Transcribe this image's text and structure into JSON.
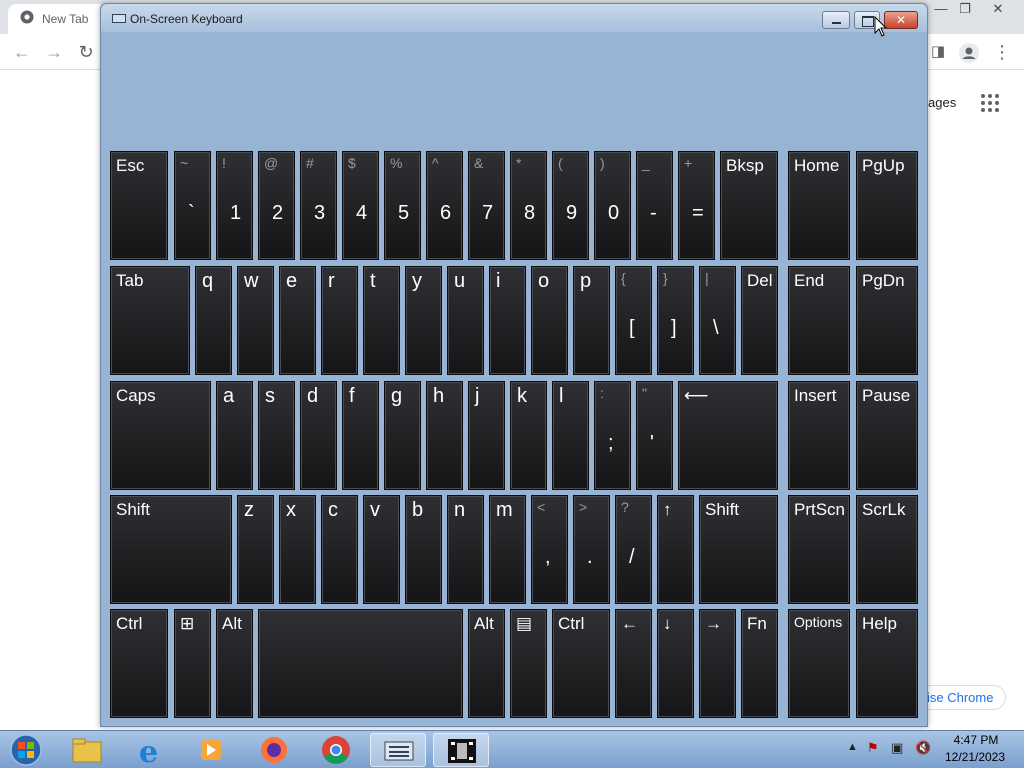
{
  "chrome": {
    "tab_title": "New Tab",
    "images_link": "ages",
    "customize_button": "ise Chrome"
  },
  "osk": {
    "title": "On-Screen Keyboard",
    "rows": [
      [
        {
          "lbl": "Esc"
        },
        {
          "shifted": "~",
          "main": "`"
        },
        {
          "shifted": "!",
          "main": "1"
        },
        {
          "shifted": "@",
          "main": "2"
        },
        {
          "shifted": "#",
          "main": "3"
        },
        {
          "shifted": "$",
          "main": "4"
        },
        {
          "shifted": "%",
          "main": "5"
        },
        {
          "shifted": "^",
          "main": "6"
        },
        {
          "shifted": "&",
          "main": "7"
        },
        {
          "shifted": "*",
          "main": "8"
        },
        {
          "shifted": "(",
          "main": "9"
        },
        {
          "shifted": ")",
          "main": "0"
        },
        {
          "shifted": "_",
          "main": "-"
        },
        {
          "shifted": "+",
          "main": "="
        },
        {
          "lbl": "Bksp"
        },
        {
          "lbl": "Home"
        },
        {
          "lbl": "PgUp"
        }
      ],
      [
        {
          "lbl": "Tab"
        },
        {
          "top": "q"
        },
        {
          "top": "w"
        },
        {
          "top": "e"
        },
        {
          "top": "r"
        },
        {
          "top": "t"
        },
        {
          "top": "y"
        },
        {
          "top": "u"
        },
        {
          "top": "i"
        },
        {
          "top": "o"
        },
        {
          "top": "p"
        },
        {
          "shifted": "{",
          "main": "["
        },
        {
          "shifted": "}",
          "main": "]"
        },
        {
          "shifted": "|",
          "main": "\\"
        },
        {
          "lbl": "Del"
        },
        {
          "lbl": "End"
        },
        {
          "lbl": "PgDn"
        }
      ],
      [
        {
          "lbl": "Caps"
        },
        {
          "top": "a"
        },
        {
          "top": "s"
        },
        {
          "top": "d"
        },
        {
          "top": "f"
        },
        {
          "top": "g"
        },
        {
          "top": "h"
        },
        {
          "top": "j"
        },
        {
          "top": "k"
        },
        {
          "top": "l"
        },
        {
          "shifted": ":",
          "main": ";"
        },
        {
          "shifted": "\"",
          "main": "'"
        },
        {
          "lbl": "⟵"
        },
        {
          "lbl": "Insert"
        },
        {
          "lbl": "Pause"
        }
      ],
      [
        {
          "lbl": "Shift"
        },
        {
          "top": "z"
        },
        {
          "top": "x"
        },
        {
          "top": "c"
        },
        {
          "top": "v"
        },
        {
          "top": "b"
        },
        {
          "top": "n"
        },
        {
          "top": "m"
        },
        {
          "shifted": "<",
          "main": ","
        },
        {
          "shifted": ">",
          "main": "."
        },
        {
          "shifted": "?",
          "main": "/"
        },
        {
          "lbl": "↑"
        },
        {
          "lbl": "Shift"
        },
        {
          "lbl": "PrtScn"
        },
        {
          "lbl": "ScrLk"
        }
      ],
      [
        {
          "lbl": "Ctrl"
        },
        {
          "lbl": "⊞"
        },
        {
          "lbl": "Alt"
        },
        {
          "lbl": ""
        },
        {
          "lbl": "Alt"
        },
        {
          "lbl": "▤"
        },
        {
          "lbl": "Ctrl"
        },
        {
          "lbl": "←"
        },
        {
          "lbl": "↓"
        },
        {
          "lbl": "→"
        },
        {
          "lbl": "Fn"
        },
        {
          "lbl": "Options"
        },
        {
          "lbl": "Help"
        }
      ]
    ]
  },
  "taskbar": {
    "items": [
      "Windows Explorer",
      "Internet Explorer",
      "Windows Media Player",
      "Firefox",
      "Google Chrome",
      "On-Screen Keyboard",
      "Movie Maker"
    ],
    "clock_time": "4:47 PM",
    "clock_date": "12/21/2023"
  }
}
